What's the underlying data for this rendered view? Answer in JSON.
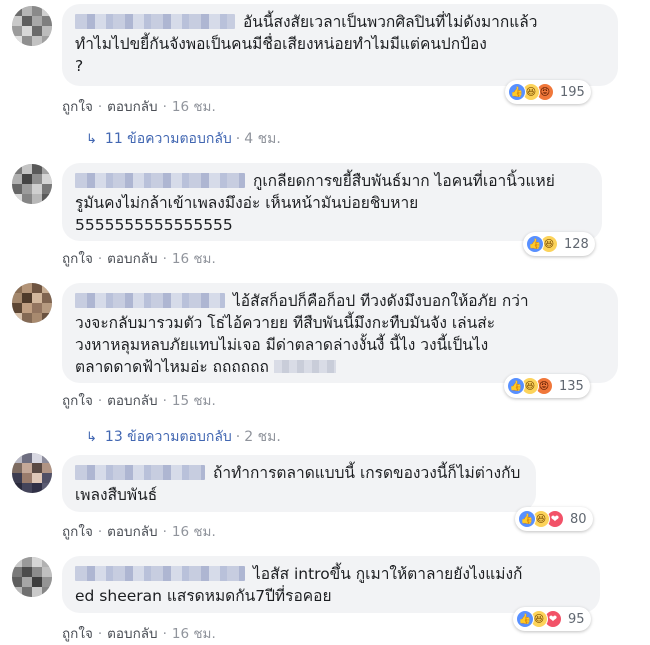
{
  "comments": [
    {
      "text": "อันนี้สงสัยเวลาเป็นพวกศิลปินที่ไม่ดังมากแล้วทำไมไปขยี้กันจังพอเป็นคนมีชื่อเสียงหน่อยทำไมมีแต่คนปกป้อง?",
      "lines": [
        "อันนี้สงสัยเวลาเป็นพวกศิลปินที่ไม่ดังมากแล้ว",
        "ทำไมไปขยี้กันจังพอเป็นคนมีชื่อเสียงหน่อยทำไมมีแต่คนปกป้อง",
        "?"
      ],
      "reactions": [
        "like",
        "haha",
        "angry"
      ],
      "reaction_count": "195",
      "like_label": "ถูกใจ",
      "reply_label": "ตอบกลับ",
      "time": "16 ชม.",
      "replies_label": "11 ข้อความตอบกลับ",
      "replies_time": "4 ชม."
    },
    {
      "lines": [
        "กูเกลียดการขยี้สืบพันธ์มาก ไอคนที่เอานิ้วแหย่",
        "รูมันคงไม่กล้าเข้าเพลงมึงอ่ะ เห็นหน้ามันบ่อยชิบหาย",
        "5555555555555555"
      ],
      "reactions": [
        "like",
        "haha"
      ],
      "reaction_count": "128",
      "like_label": "ถูกใจ",
      "reply_label": "ตอบกลับ",
      "time": "16 ชม."
    },
    {
      "lines": [
        "ไอ้สัสก็อปก็คือก็อป ทีวงดังมึงบอกให้อภัย กว่า",
        "วงจะกลับมารวมตัว โธ่ไอ้ควายย ทีสืบพันนี้มึงกะทืบมันจัง เล่นส่ะ",
        "วงหาหลุมหลบภัยแทบไม่เจอ มีด่าตลาดล่างงั้นงี้ นี้ไง วงนี้เป็นไง",
        "ตลาดดาดฟ้าไหมอ่ะ ถถถถถถ"
      ],
      "reactions": [
        "like",
        "haha",
        "angry"
      ],
      "reaction_count": "135",
      "like_label": "ถูกใจ",
      "reply_label": "ตอบกลับ",
      "time": "15 ชม.",
      "replies_label": "13 ข้อความตอบกลับ",
      "replies_time": "2 ชม."
    },
    {
      "lines": [
        "ถ้าทำการตลาดแบบนี้ เกรดของวงนี้ก็ไม่ต่างกับ",
        "เพลงสืบพันธ์"
      ],
      "reactions": [
        "like",
        "haha",
        "love"
      ],
      "reaction_count": "80",
      "like_label": "ถูกใจ",
      "reply_label": "ตอบกลับ",
      "time": "16 ชม."
    },
    {
      "lines": [
        "ไอสัส introขึ้น กูเมาให้ตาลายยังไงแม่งก้",
        "ed sheeran แสรดหมดกัน7ปีที่รอคอย"
      ],
      "reactions": [
        "like",
        "haha",
        "love"
      ],
      "reaction_count": "95",
      "like_label": "ถูกใจ",
      "reply_label": "ตอบกลับ",
      "time": "16 ชม."
    }
  ],
  "icons": {
    "like": "thumbs-up-icon",
    "haha": "laughing-face-icon",
    "angry": "angry-face-icon",
    "love": "heart-icon",
    "reply_arrow": "reply-arrow-icon"
  },
  "colors": {
    "bubble": "#f2f3f5",
    "link": "#4267b2",
    "like": "#5890ff",
    "haha": "#fcd35a",
    "angry": "#f0773a",
    "love": "#f25268",
    "meta": "#606770"
  }
}
